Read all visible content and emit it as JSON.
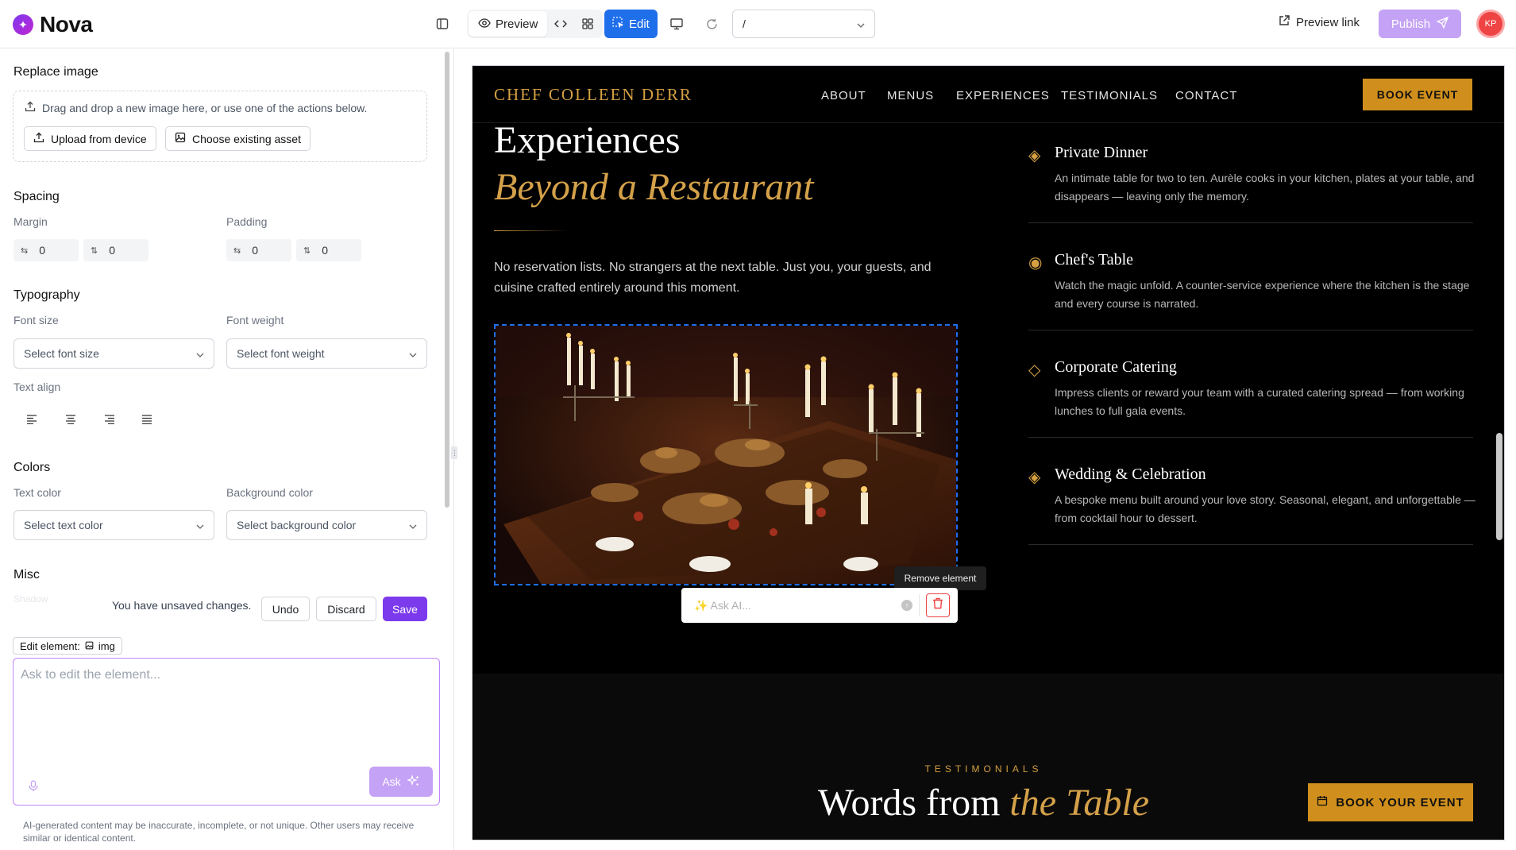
{
  "app": {
    "name": "Nova",
    "logo_mark": "✦"
  },
  "toolbar": {
    "preview_label": "Preview",
    "edit_label": "Edit",
    "route_value": "/",
    "preview_link_label": "Preview link",
    "publish_label": "Publish",
    "avatar_initials": "KP"
  },
  "panel": {
    "replace_image": {
      "heading": "Replace image",
      "dropzone_text": "Drag and drop a new image here, or use one of the actions below.",
      "upload_label": "Upload from device",
      "choose_label": "Choose existing asset"
    },
    "spacing": {
      "heading": "Spacing",
      "margin_label": "Margin",
      "padding_label": "Padding",
      "margin_x": "0",
      "margin_y": "0",
      "padding_x": "0",
      "padding_y": "0"
    },
    "typography": {
      "heading": "Typography",
      "font_size_label": "Font size",
      "font_size_placeholder": "Select font size",
      "font_weight_label": "Font weight",
      "font_weight_placeholder": "Select font weight",
      "text_align_label": "Text align"
    },
    "colors": {
      "heading": "Colors",
      "text_color_label": "Text color",
      "text_color_placeholder": "Select text color",
      "bg_color_label": "Background color",
      "bg_color_placeholder": "Select background color"
    },
    "misc": {
      "heading": "Misc",
      "shadow_label": "Shadow"
    },
    "unsaved": {
      "message": "You have unsaved changes.",
      "undo_label": "Undo",
      "discard_label": "Discard",
      "save_label": "Save"
    },
    "edit_element": {
      "label": "Edit element:",
      "tag": "img"
    },
    "ask": {
      "placeholder": "Ask to edit the element...",
      "button_label": "Ask",
      "disclaimer": "AI-generated content may be inaccurate, incomplete, or not unique. Other users may receive similar or identical content."
    }
  },
  "site": {
    "brand": "CHEF COLLEEN DERR",
    "nav": [
      "ABOUT",
      "MENUS",
      "EXPERIENCES",
      "TESTIMONIALS",
      "CONTACT"
    ],
    "book_event": "BOOK EVENT",
    "hero": {
      "title_line1": "Experiences",
      "title_line2": "Beyond a Restaurant",
      "lead": "No reservation lists. No strangers at the next table. Just you, your guests, and cuisine crafted entirely around this moment."
    },
    "image_overlay": {
      "tooltip": "Remove element",
      "ask_placeholder": "✨ Ask AI..."
    },
    "services": [
      {
        "title": "Private Dinner",
        "desc": "An intimate table for two to ten. Aurèle cooks in your kitchen, plates at your table, and disappears — leaving only the memory.",
        "icon": "◈"
      },
      {
        "title": "Chef's Table",
        "desc": "Watch the magic unfold. A counter-service experience where the kitchen is the stage and every course is narrated.",
        "icon": "◉"
      },
      {
        "title": "Corporate Catering",
        "desc": "Impress clients or reward your team with a curated catering spread — from working lunches to full gala events.",
        "icon": "◇"
      },
      {
        "title": "Wedding & Celebration",
        "desc": "A bespoke menu built around your love story. Seasonal, elegant, and unforgettable — from cocktail hour to dessert.",
        "icon": "◈"
      }
    ],
    "testimonials": {
      "kicker": "TESTIMONIALS",
      "title_plain": "Words from ",
      "title_em": "the Table",
      "cta": "BOOK YOUR EVENT"
    }
  },
  "colors": {
    "accent_gold": "#d4a041",
    "edit_blue": "#1f6feb",
    "save_purple": "#7c3aed"
  }
}
